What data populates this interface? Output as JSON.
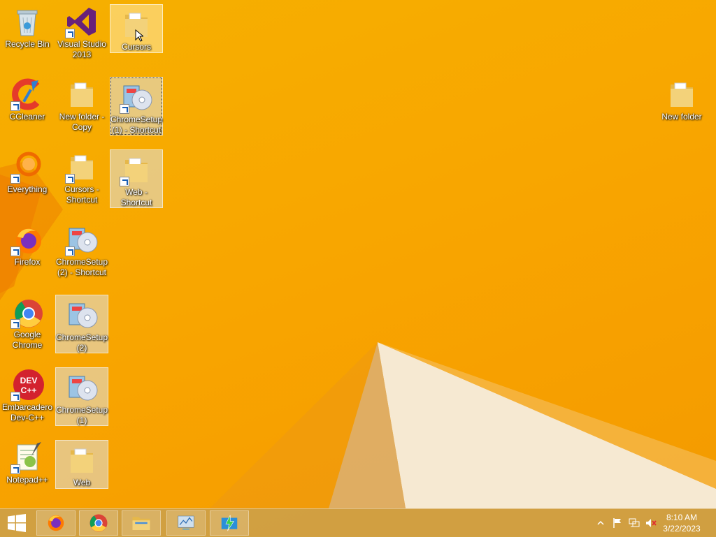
{
  "desktop": {
    "icons": [
      {
        "label": "Recycle Bin"
      },
      {
        "label": "Visual Studio 2013"
      },
      {
        "label": "Cursors"
      },
      {
        "label": "CCleaner"
      },
      {
        "label": "New folder - Copy"
      },
      {
        "label": "ChromeSetup (1) - Shortcut"
      },
      {
        "label": "Everything"
      },
      {
        "label": "Cursors - Shortcut"
      },
      {
        "label": "Web - Shortcut"
      },
      {
        "label": "Firefox"
      },
      {
        "label": "ChromeSetup (2) - Shortcut"
      },
      {
        "label": "Google Chrome"
      },
      {
        "label": "ChromeSetup (2)"
      },
      {
        "label": "Embarcadero Dev-C++"
      },
      {
        "label": "ChromeSetup (1)"
      },
      {
        "label": "Notepad++"
      },
      {
        "label": "Web"
      },
      {
        "label": "New folder"
      }
    ]
  },
  "taskbar": {
    "clock": {
      "time": "8:10 AM",
      "date": "3/22/2023"
    },
    "pinned": [
      "firefox-icon",
      "chrome-icon",
      "file-explorer-icon",
      "network-app-icon",
      "flash-app-icon"
    ]
  },
  "colors": {
    "wallpaper": "#f7a800",
    "folder": "#f3d27a",
    "accent": "#1a5fb4"
  }
}
